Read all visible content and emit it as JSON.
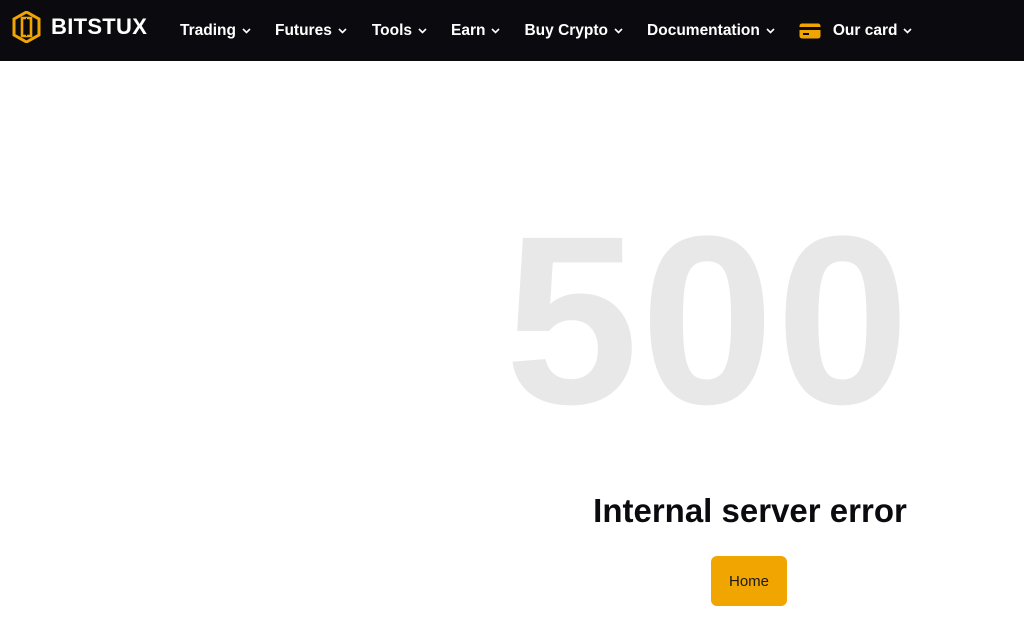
{
  "brand": {
    "name": "BITSTUX",
    "logo_icon": "bitstux-hexagon-logo",
    "accent_color": "#f0a500"
  },
  "nav": {
    "items": [
      {
        "label": "Trading",
        "icon": "chevron-down-icon"
      },
      {
        "label": "Futures",
        "icon": "chevron-down-icon"
      },
      {
        "label": "Tools",
        "icon": "chevron-down-icon"
      },
      {
        "label": "Earn",
        "icon": "chevron-down-icon"
      },
      {
        "label": "Buy Crypto",
        "icon": "chevron-down-icon"
      },
      {
        "label": "Documentation",
        "icon": "chevron-down-icon"
      },
      {
        "label": "Our card",
        "icon": "chevron-down-icon",
        "leading_icon": "credit-card-icon"
      }
    ]
  },
  "error": {
    "code": "500",
    "title": "Internal server error",
    "home_button": "Home"
  },
  "colors": {
    "topbar_bg": "#0b0b0f",
    "code_color": "#e8e8e8",
    "button_bg": "#f0a500"
  }
}
